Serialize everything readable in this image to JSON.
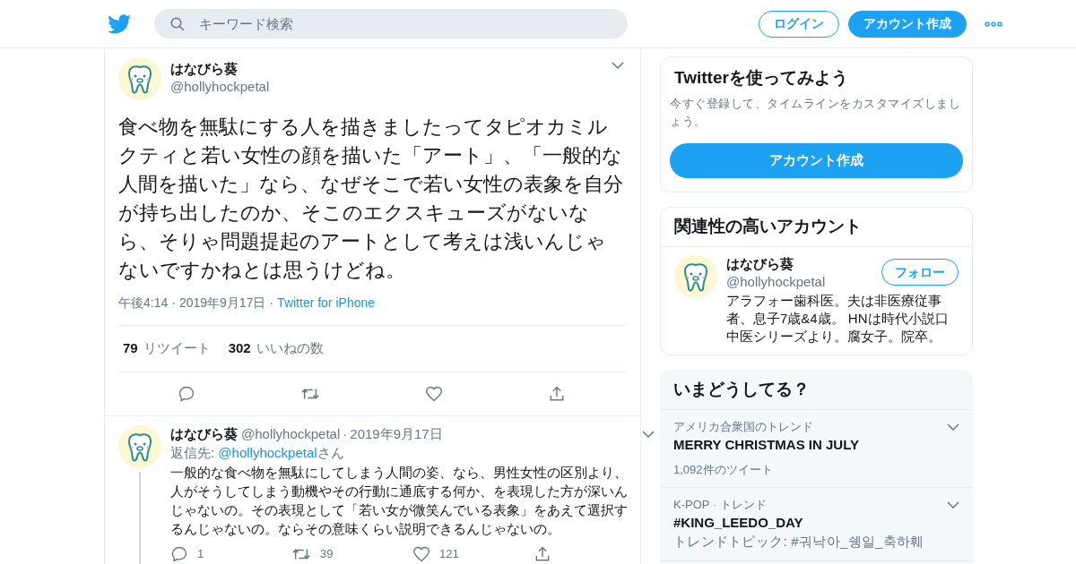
{
  "header": {
    "search": {
      "placeholder": "キーワード検索"
    },
    "buttons": [
      {
        "label": "ログイン",
        "kind": "outline"
      },
      {
        "label": "アカウント作成",
        "kind": "filled"
      }
    ]
  },
  "tweet": {
    "name": "はなびら葵",
    "handle": "@hollyhockpetal",
    "text": "食べ物を無駄にする人を描きましたってタピオカミルクティと若い女性の顔を描いた「アート」、「一般的な人間を描いた」なら、なぜそこで若い女性の表象を自分が持ち出したのか、そこのエクスキューズがないなら、そりゃ問題提起のアートとして考えは浅いんじゃないですかねとは思うけどね。",
    "separator": "·",
    "time": "午後4:14",
    "date": "2019年9月17日",
    "source": "Twitter for iPhone",
    "stats": [
      {
        "count": "79",
        "label": "リツイート"
      },
      {
        "count": "302",
        "label": "いいねの数"
      }
    ]
  },
  "reply": {
    "name": "はなびら葵",
    "handle": "@hollyhockpetal",
    "separator": "·",
    "date": "2019年9月17日",
    "reply_prefix": "返信先:",
    "reply_to": "@hollyhockpetal",
    "reply_suffix": "さん",
    "text": "一般的な食べ物を無駄にしてしまう人間の姿、なら、男性女性の区別より、人がそうしてしまう動機やその行動に通底する何か、を表現した方が深いんじゃないの。その表現として「若い女が微笑んでいる表象」をあえて選択するんじゃないの。ならその意味くらい説明できるんじゃないの。",
    "actions": [
      {
        "kind": "reply",
        "count": "1"
      },
      {
        "kind": "retweet",
        "count": "39"
      },
      {
        "kind": "like",
        "count": "121"
      },
      {
        "kind": "share"
      }
    ]
  },
  "signup": {
    "title": "Twitterを使ってみよう",
    "text": "今すぐ登録して、タイムラインをカスタマイズしましょう。",
    "button": "アカウント作成"
  },
  "related": {
    "title": "関連性の高いアカウント",
    "account": {
      "name": "はなびら葵",
      "handle": "@hollyhockpetal",
      "bio": "アラフォー歯科医。夫は非医療従事者、息子7歳&4歳。 HNは時代小説口中医シリーズより。腐女子。院卒。",
      "button": "フォロー"
    }
  },
  "trends": {
    "title": "いまどうしてる？",
    "items": [
      {
        "context": "アメリカ合衆国のトレンド",
        "name": "MERRY CHRISTMAS IN JULY",
        "count": "1,092件のツイート"
      },
      {
        "context": "K-POP · トレンド",
        "name": "#KING_LEEDO_DAY",
        "topic": "トレンドトピック: #궈낙아_쉥일_축하훼"
      }
    ]
  }
}
